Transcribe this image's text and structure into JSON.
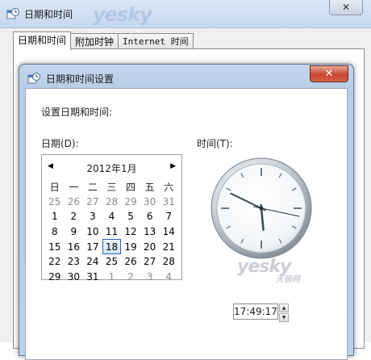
{
  "outer_window": {
    "title": "日期和时间",
    "close_glyph": "✕",
    "watermark": "yesky",
    "tabs": [
      {
        "label": "日期和时间",
        "active": true
      },
      {
        "label": "附加时钟",
        "active": false
      },
      {
        "label": "Internet 时间",
        "active": false
      }
    ]
  },
  "dialog": {
    "title": "日期和时间设置",
    "close_glyph": "✕",
    "instruction": "设置日期和时间:",
    "date_label": "日期(D):",
    "time_label": "时间(T):",
    "calendar": {
      "prev_glyph": "◀",
      "next_glyph": "▶",
      "month_title": "2012年1月",
      "weekdays": [
        "日",
        "一",
        "二",
        "三",
        "四",
        "五",
        "六"
      ],
      "weeks": [
        [
          "25",
          "26",
          "27",
          "28",
          "29",
          "30",
          "31"
        ],
        [
          "1",
          "2",
          "3",
          "4",
          "5",
          "6",
          "7"
        ],
        [
          "8",
          "9",
          "10",
          "11",
          "12",
          "13",
          "14"
        ],
        [
          "15",
          "16",
          "17",
          "18",
          "19",
          "20",
          "21"
        ],
        [
          "22",
          "23",
          "24",
          "25",
          "26",
          "27",
          "28"
        ],
        [
          "29",
          "30",
          "31",
          "1",
          "2",
          "3",
          "4"
        ]
      ],
      "selected_day": "18"
    },
    "clock": {
      "hour": 17,
      "minute": 49,
      "second": 17
    },
    "time_value": "17:49:17",
    "spin_up_glyph": "▲",
    "spin_down_glyph": "▼"
  },
  "watermark": {
    "brand": "yesky",
    "brand_cn": "天极网"
  }
}
